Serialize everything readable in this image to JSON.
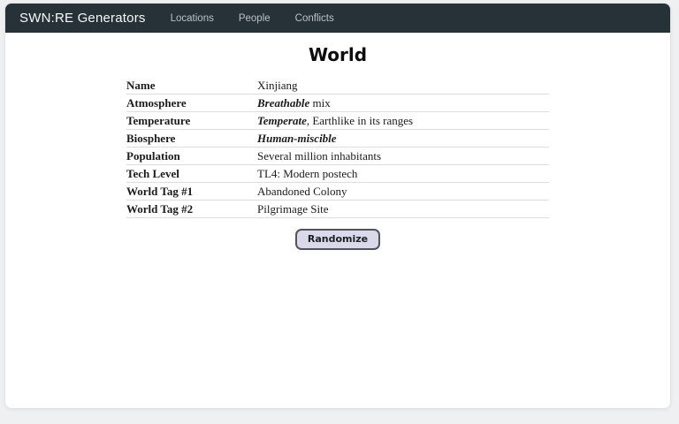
{
  "navbar": {
    "brand": "SWN:RE Generators",
    "items": [
      {
        "label": "Locations"
      },
      {
        "label": "People"
      },
      {
        "label": "Conflicts"
      }
    ]
  },
  "page": {
    "title": "World",
    "randomize_label": "Randomize"
  },
  "world_table": {
    "rows": [
      {
        "label": "Name",
        "value_emphasis": "",
        "value_rest": "Xinjiang"
      },
      {
        "label": "Atmosphere",
        "value_emphasis": "Breathable",
        "value_rest": " mix"
      },
      {
        "label": "Temperature",
        "value_emphasis": "Temperate",
        "value_rest": ", Earthlike in its ranges"
      },
      {
        "label": "Biosphere",
        "value_emphasis": "Human-miscible",
        "value_rest": ""
      },
      {
        "label": "Population",
        "value_emphasis": "",
        "value_rest": "Several million inhabitants"
      },
      {
        "label": "Tech Level",
        "value_emphasis": "",
        "value_rest": "TL4: Modern postech"
      },
      {
        "label": "World Tag #1",
        "value_emphasis": "",
        "value_rest": "Abandoned Colony"
      },
      {
        "label": "World Tag #2",
        "value_emphasis": "",
        "value_rest": "Pilgrimage Site"
      }
    ]
  },
  "colors": {
    "navbar_bg": "#263238",
    "page_bg": "#eef0f1",
    "card_bg": "#ffffff",
    "table_border": "#dddddd",
    "button_bg": "#d9d9ea",
    "button_border": "#53535e"
  }
}
